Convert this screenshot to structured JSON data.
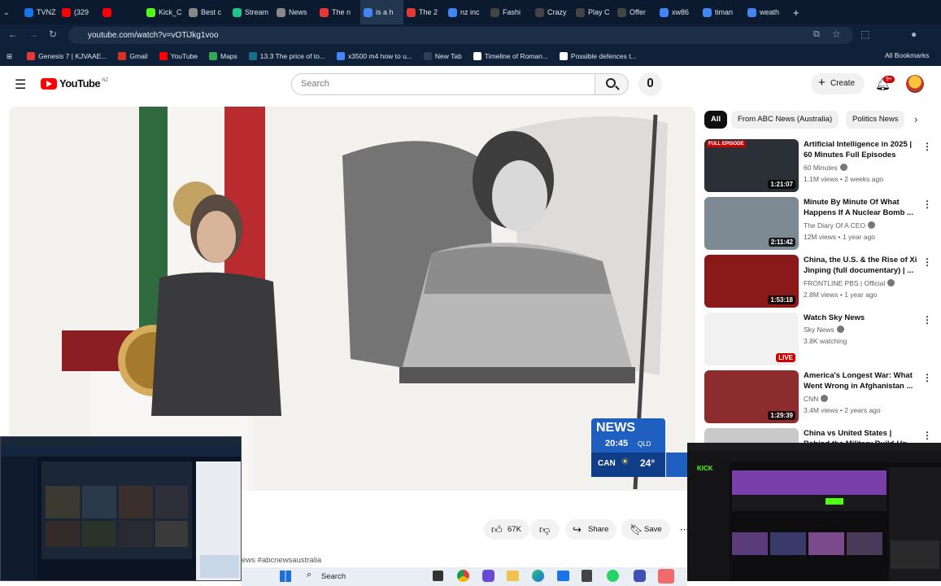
{
  "browser": {
    "tabs": [
      {
        "label": "TVNZ",
        "color": "#1a73e8"
      },
      {
        "label": "(329",
        "color": "#ff0000"
      },
      {
        "label": "",
        "color": "#ff0000"
      },
      {
        "label": "Kick_C",
        "color": "#53fc18"
      },
      {
        "label": "Best c",
        "color": "#888888"
      },
      {
        "label": "Stream",
        "color": "#1ec68c"
      },
      {
        "label": "News",
        "color": "#888888"
      },
      {
        "label": "The n",
        "color": "#e53935"
      },
      {
        "label": "is a h",
        "color": "#4285f4"
      },
      {
        "label": "The 2",
        "color": "#e53935"
      },
      {
        "label": "nz inc",
        "color": "#4285f4"
      },
      {
        "label": "Fashi",
        "color": "#444444"
      },
      {
        "label": "Crazy",
        "color": "#444444"
      },
      {
        "label": "Play C",
        "color": "#444444"
      },
      {
        "label": "Offer",
        "color": "#444444"
      },
      {
        "label": "xw86",
        "color": "#4285f4"
      },
      {
        "label": "timan",
        "color": "#4285f4"
      },
      {
        "label": "weath",
        "color": "#4285f4"
      }
    ],
    "url": "youtube.com/watch?v=vOTiJkg1voo",
    "bookmarks": [
      {
        "label": "Genesis 7 | KJVAAE...",
        "color": "#e53935"
      },
      {
        "label": "Gmail",
        "color": "#d93025"
      },
      {
        "label": "YouTube",
        "color": "#ff0000"
      },
      {
        "label": "Maps",
        "color": "#34a853"
      },
      {
        "label": "13.3 The price of to...",
        "color": "#1b6b8a"
      },
      {
        "label": "x3500 m4 how to u...",
        "color": "#4285f4"
      },
      {
        "label": "New Tab",
        "color": "#2d3e56"
      },
      {
        "label": "Timeline of Roman...",
        "color": "#ffffff"
      },
      {
        "label": "Possible defences t...",
        "color": "#ffffff"
      }
    ],
    "all_bookmarks": "All Bookmarks"
  },
  "youtube": {
    "logo_text": "YouTube",
    "region": "NZ",
    "search_placeholder": "Search",
    "create_label": "Create",
    "notifications_badge": "9+",
    "chips": [
      "All",
      "From ABC News (Australia)",
      "Politics News"
    ],
    "actions": {
      "likes": "67K",
      "share": "Share",
      "save": "Save"
    },
    "hashtag_text": "ews #abcnewsaustralia",
    "news_bug": {
      "brand": "NEWS",
      "time": "20:45",
      "zone": "QLD",
      "city": "CAN",
      "temp": "24°"
    },
    "recommendations": [
      {
        "title": "Artificial Intelligence in 2025 | 60 Minutes Full Episodes",
        "channel": "60 Minutes",
        "meta": "1.1M views • 2 weeks ago",
        "duration": "1:21:07",
        "thumb_color": "#2b2f36",
        "badge": "FULL EPISODE"
      },
      {
        "title": "Minute By Minute Of What Happens If A Nuclear Bomb ...",
        "channel": "The Diary Of A CEO",
        "meta": "12M views • 1 year ago",
        "duration": "2:11:42",
        "thumb_color": "#7d8a93",
        "badge": ""
      },
      {
        "title": "China, the U.S. & the Rise of Xi Jinping (full documentary) | ...",
        "channel": "FRONTLINE PBS | Official",
        "meta": "2.8M views • 1 year ago",
        "duration": "1:53:18",
        "thumb_color": "#8a1a1a",
        "badge": ""
      },
      {
        "title": "Watch Sky News",
        "channel": "Sky News",
        "meta": "3.8K watching",
        "duration": "LIVE",
        "thumb_color": "#f1f1f1",
        "badge": ""
      },
      {
        "title": "America's Longest War: What Went Wrong in Afghanistan ...",
        "channel": "CNN",
        "meta": "3.4M views • 2 years ago",
        "duration": "1:29:39",
        "thumb_color": "#8c2c2c",
        "badge": ""
      },
      {
        "title": "China vs United States | Behind the Military Build-Up ...",
        "channel": "",
        "meta": "",
        "duration": "",
        "thumb_color": "#c9c9c9",
        "badge": ""
      }
    ]
  },
  "taskbar": {
    "search_label": "Search"
  }
}
